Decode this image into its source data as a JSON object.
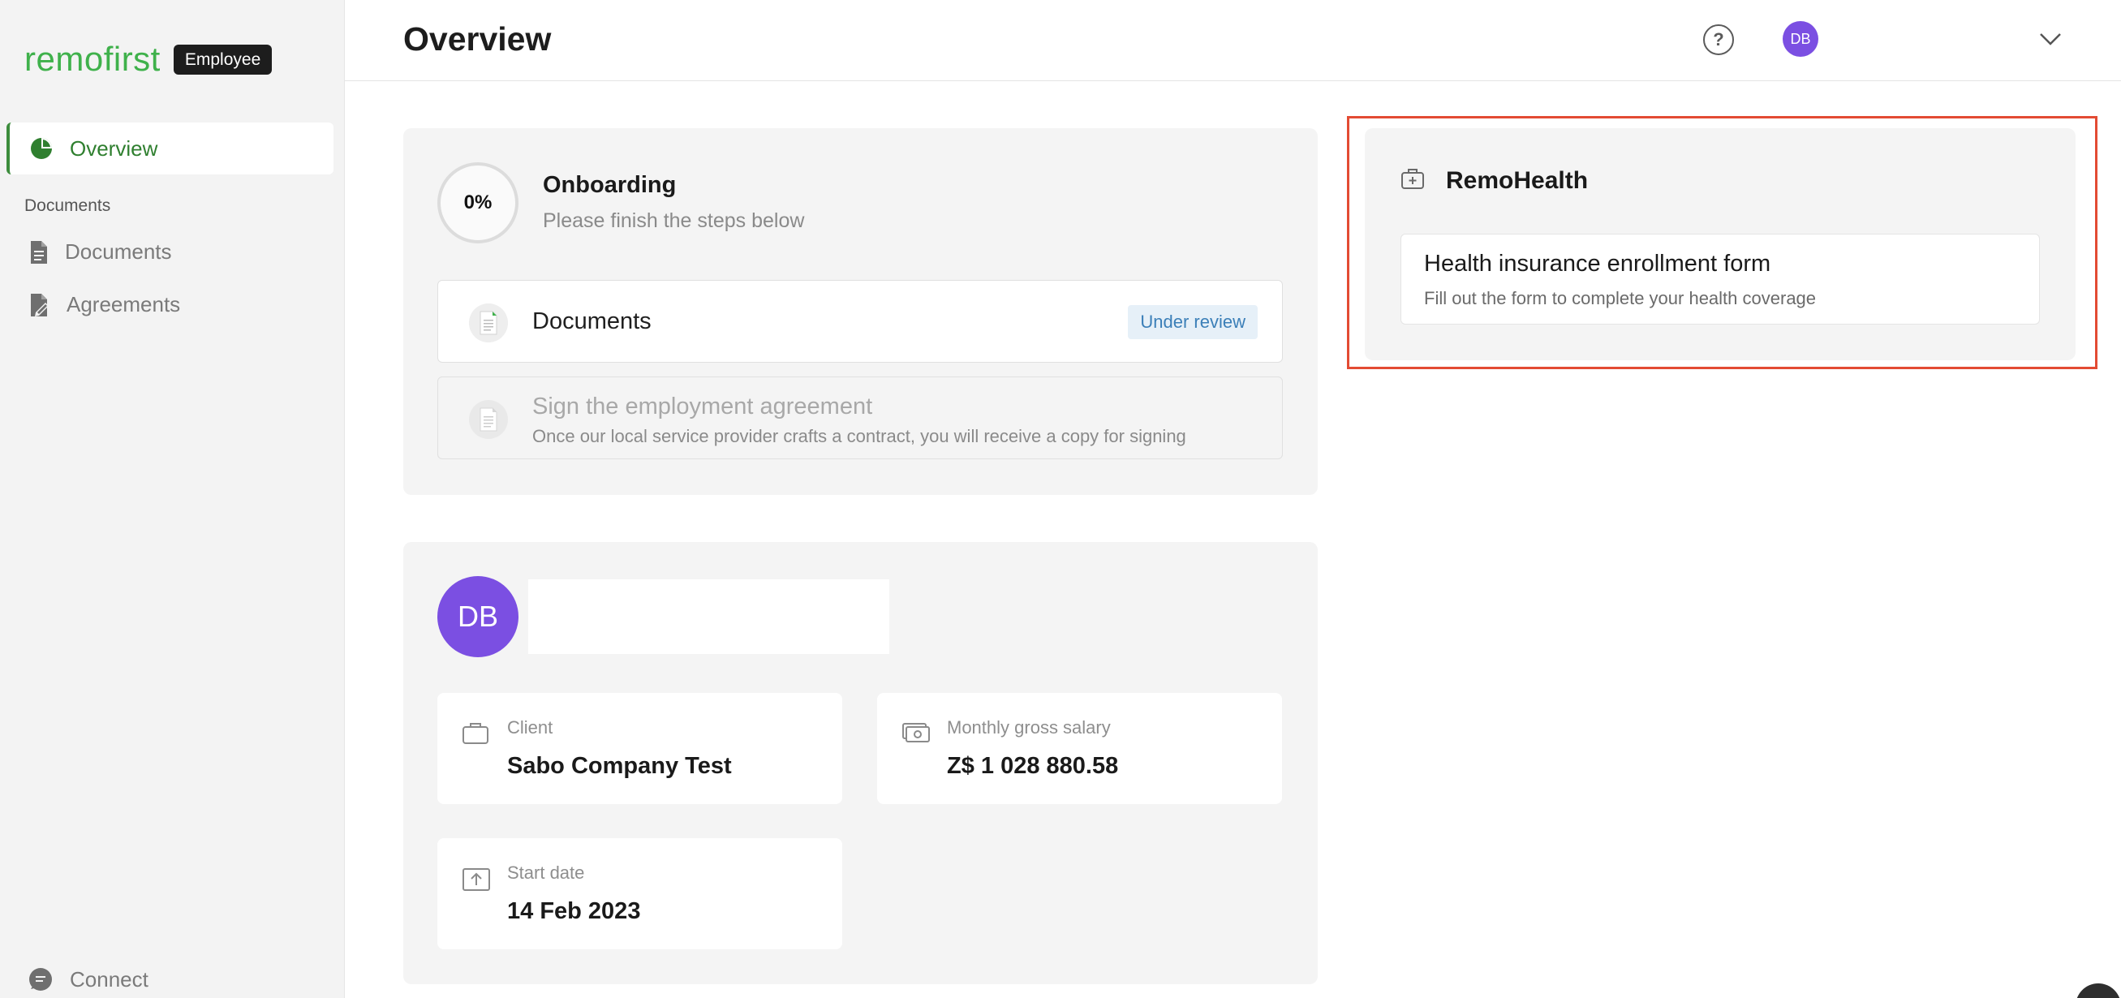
{
  "brand": {
    "name": "remofirst",
    "badge": "Employee"
  },
  "sidebar": {
    "active_item": "Overview",
    "section_label": "Documents",
    "items": [
      {
        "label": "Documents",
        "icon": "document-icon"
      },
      {
        "label": "Agreements",
        "icon": "agreement-icon"
      }
    ],
    "connect_label": "Connect"
  },
  "header": {
    "title": "Overview",
    "help_icon": "question-circle-icon",
    "avatar_initials": "DB"
  },
  "onboarding": {
    "progress": "0%",
    "title": "Onboarding",
    "subtitle": "Please finish the steps below",
    "steps": [
      {
        "title": "Documents",
        "status": "Under review"
      },
      {
        "title": "Sign the employment agreement",
        "description": "Once our local service provider crafts a contract, you will receive a copy for signing"
      }
    ]
  },
  "profile": {
    "avatar_initials": "DB",
    "client": {
      "label": "Client",
      "value": "Sabo Company Test"
    },
    "salary": {
      "label": "Monthly gross salary",
      "value": "Z$ 1 028 880.58"
    },
    "start_date": {
      "label": "Start date",
      "value": "14 Feb 2023"
    }
  },
  "remohealth": {
    "title": "RemoHealth",
    "item_title": "Health insurance enrollment form",
    "item_subtitle": "Fill out the form to complete your health coverage"
  },
  "colors": {
    "brand_green": "#3fb14b",
    "active_green": "#2f7f2f",
    "avatar_purple": "#7b4fe2",
    "badge_blue": "#3b7fb8",
    "highlight_red": "#e34b33"
  }
}
